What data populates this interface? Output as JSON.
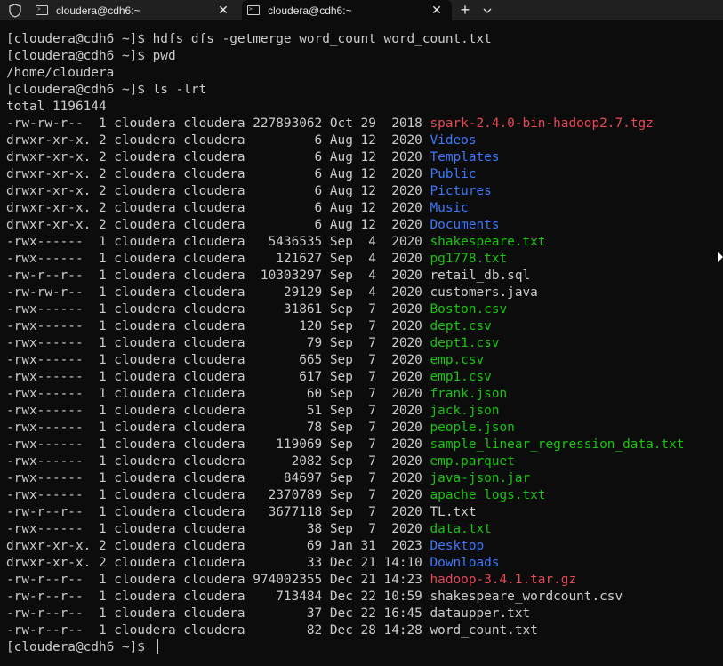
{
  "tabs": [
    {
      "label": "cloudera@cdh6:~",
      "icon": "terminal-icon",
      "active": false
    },
    {
      "label": "cloudera@cdh6:~",
      "icon": "terminal-icon",
      "active": true
    }
  ],
  "titlebar": {
    "close_glyph": "✕",
    "new_tab_glyph": "+"
  },
  "colors": {
    "background": "#0c0c0c",
    "text": "#cccccc",
    "red": "#e74856",
    "blue": "#3b78ff",
    "green": "#16c60c"
  },
  "terminal": {
    "lines": [
      {
        "text": "[cloudera@cdh6 ~]$ hdfs dfs -getmerge word_count word_count.txt"
      },
      {
        "text": "[cloudera@cdh6 ~]$ pwd"
      },
      {
        "text": "/home/cloudera"
      },
      {
        "text": "[cloudera@cdh6 ~]$ ls -lrt"
      },
      {
        "text": "total 1196144"
      },
      {
        "prefix": "-rw-rw-r--  1 cloudera cloudera 227893062 Oct 29  2018 ",
        "name": "spark-2.4.0-bin-hadoop2.7.tgz",
        "color": "red"
      },
      {
        "prefix": "drwxr-xr-x. 2 cloudera cloudera         6 Aug 12  2020 ",
        "name": "Videos",
        "color": "blue"
      },
      {
        "prefix": "drwxr-xr-x. 2 cloudera cloudera         6 Aug 12  2020 ",
        "name": "Templates",
        "color": "blue"
      },
      {
        "prefix": "drwxr-xr-x. 2 cloudera cloudera         6 Aug 12  2020 ",
        "name": "Public",
        "color": "blue"
      },
      {
        "prefix": "drwxr-xr-x. 2 cloudera cloudera         6 Aug 12  2020 ",
        "name": "Pictures",
        "color": "blue"
      },
      {
        "prefix": "drwxr-xr-x. 2 cloudera cloudera         6 Aug 12  2020 ",
        "name": "Music",
        "color": "blue"
      },
      {
        "prefix": "drwxr-xr-x. 2 cloudera cloudera         6 Aug 12  2020 ",
        "name": "Documents",
        "color": "blue"
      },
      {
        "prefix": "-rwx------  1 cloudera cloudera   5436535 Sep  4  2020 ",
        "name": "shakespeare.txt",
        "color": "green"
      },
      {
        "prefix": "-rwx------  1 cloudera cloudera    121627 Sep  4  2020 ",
        "name": "pg1778.txt",
        "color": "green"
      },
      {
        "prefix": "-rw-r--r--  1 cloudera cloudera  10303297 Sep  4  2020 ",
        "name": "retail_db.sql",
        "color": "plain"
      },
      {
        "prefix": "-rw-rw-r--  1 cloudera cloudera     29129 Sep  4  2020 ",
        "name": "customers.java",
        "color": "plain"
      },
      {
        "prefix": "-rwx------  1 cloudera cloudera     31861 Sep  7  2020 ",
        "name": "Boston.csv",
        "color": "green"
      },
      {
        "prefix": "-rwx------  1 cloudera cloudera       120 Sep  7  2020 ",
        "name": "dept.csv",
        "color": "green"
      },
      {
        "prefix": "-rwx------  1 cloudera cloudera        79 Sep  7  2020 ",
        "name": "dept1.csv",
        "color": "green"
      },
      {
        "prefix": "-rwx------  1 cloudera cloudera       665 Sep  7  2020 ",
        "name": "emp.csv",
        "color": "green"
      },
      {
        "prefix": "-rwx------  1 cloudera cloudera       617 Sep  7  2020 ",
        "name": "emp1.csv",
        "color": "green"
      },
      {
        "prefix": "-rwx------  1 cloudera cloudera        60 Sep  7  2020 ",
        "name": "frank.json",
        "color": "green"
      },
      {
        "prefix": "-rwx------  1 cloudera cloudera        51 Sep  7  2020 ",
        "name": "jack.json",
        "color": "green"
      },
      {
        "prefix": "-rwx------  1 cloudera cloudera        78 Sep  7  2020 ",
        "name": "people.json",
        "color": "green"
      },
      {
        "prefix": "-rwx------  1 cloudera cloudera    119069 Sep  7  2020 ",
        "name": "sample_linear_regression_data.txt",
        "color": "green"
      },
      {
        "prefix": "-rwx------  1 cloudera cloudera      2082 Sep  7  2020 ",
        "name": "emp.parquet",
        "color": "green"
      },
      {
        "prefix": "-rwx------  1 cloudera cloudera     84697 Sep  7  2020 ",
        "name": "java-json.jar",
        "color": "green"
      },
      {
        "prefix": "-rwx------  1 cloudera cloudera   2370789 Sep  7  2020 ",
        "name": "apache_logs.txt",
        "color": "green"
      },
      {
        "prefix": "-rw-r--r--  1 cloudera cloudera   3677118 Sep  7  2020 ",
        "name": "TL.txt",
        "color": "plain"
      },
      {
        "prefix": "-rwx------  1 cloudera cloudera        38 Sep  7  2020 ",
        "name": "data.txt",
        "color": "green"
      },
      {
        "prefix": "drwxr-xr-x. 2 cloudera cloudera        69 Jan 31  2023 ",
        "name": "Desktop",
        "color": "blue"
      },
      {
        "prefix": "drwxr-xr-x. 2 cloudera cloudera        33 Dec 21 14:10 ",
        "name": "Downloads",
        "color": "blue"
      },
      {
        "prefix": "-rw-r--r--  1 cloudera cloudera 974002355 Dec 21 14:23 ",
        "name": "hadoop-3.4.1.tar.gz",
        "color": "red"
      },
      {
        "prefix": "-rw-r--r--  1 cloudera cloudera    713484 Dec 22 10:59 ",
        "name": "shakespeare_wordcount.csv",
        "color": "plain"
      },
      {
        "prefix": "-rw-r--r--  1 cloudera cloudera        37 Dec 22 16:45 ",
        "name": "dataupper.txt",
        "color": "plain"
      },
      {
        "prefix": "-rw-r--r--  1 cloudera cloudera        82 Dec 28 14:28 ",
        "name": "word_count.txt",
        "color": "plain"
      },
      {
        "text": "[cloudera@cdh6 ~]$ ",
        "cursor": true
      }
    ]
  }
}
